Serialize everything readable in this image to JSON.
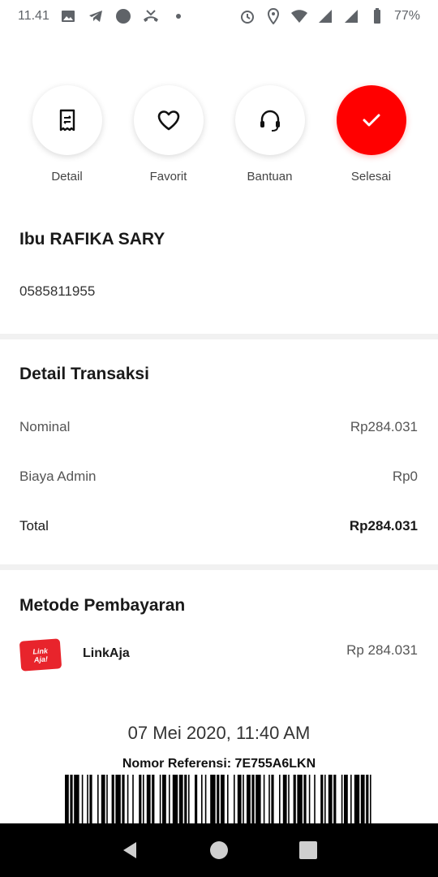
{
  "status": {
    "time": "11.41",
    "battery": "77%",
    "left_icons": [
      "image-icon",
      "telegram-icon",
      "record-icon",
      "missed-call-icon",
      "dot-icon"
    ],
    "right_icons": [
      "alarm-icon",
      "location-icon",
      "wifi-icon",
      "signal-icon",
      "signal-icon",
      "battery-icon"
    ]
  },
  "actions": [
    {
      "label": "Detail",
      "icon": "receipt-icon"
    },
    {
      "label": "Favorit",
      "icon": "heart-icon"
    },
    {
      "label": "Bantuan",
      "icon": "headset-icon"
    },
    {
      "label": "Selesai",
      "icon": "check-icon"
    }
  ],
  "customer": {
    "name": "Ibu RAFIKA SARY",
    "id": "0585811955"
  },
  "transaction": {
    "title": "Detail Transaksi",
    "rows": [
      {
        "label": "Nominal",
        "value": "Rp284.031"
      },
      {
        "label": "Biaya Admin",
        "value": "Rp0"
      },
      {
        "label": "Total",
        "value": "Rp284.031"
      }
    ]
  },
  "payment": {
    "title": "Metode Pembayaran",
    "logo_line1": "Link",
    "logo_line2": "Aja!",
    "method": "LinkAja",
    "amount": "Rp 284.031"
  },
  "timestamp": "07 Mei 2020, 11:40 AM",
  "reference": "Nomor Referensi: 7E755A6LKN",
  "colors": {
    "accent": "#ff0000",
    "linkaja": "#e8242c",
    "divider": "#f1f1f1",
    "navbar": "#000000"
  }
}
